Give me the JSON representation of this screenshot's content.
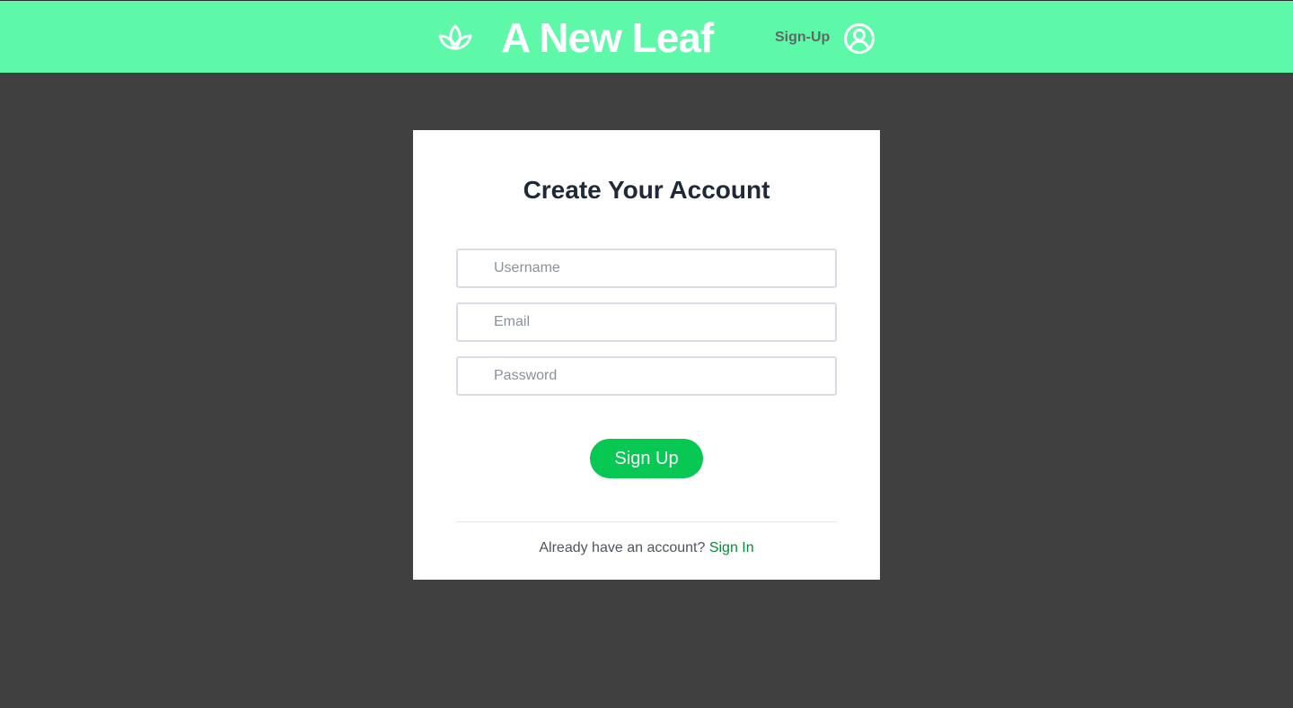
{
  "header": {
    "brand_title": "A New Leaf",
    "signup_label": "Sign-Up",
    "logo_icon": "leaf-icon",
    "account_icon": "user-circle-icon"
  },
  "form": {
    "title": "Create Your Account",
    "username": {
      "value": "",
      "placeholder": "Username"
    },
    "email": {
      "value": "",
      "placeholder": "Email"
    },
    "password": {
      "value": "",
      "placeholder": "Password"
    },
    "submit_label": "Sign Up"
  },
  "footer": {
    "prompt": "Already have an account?",
    "signin_label": "Sign In"
  },
  "colors": {
    "header_bg": "#5ef8a9",
    "page_bg": "#404040",
    "button_bg": "#07c853",
    "link": "#0b8a37"
  }
}
